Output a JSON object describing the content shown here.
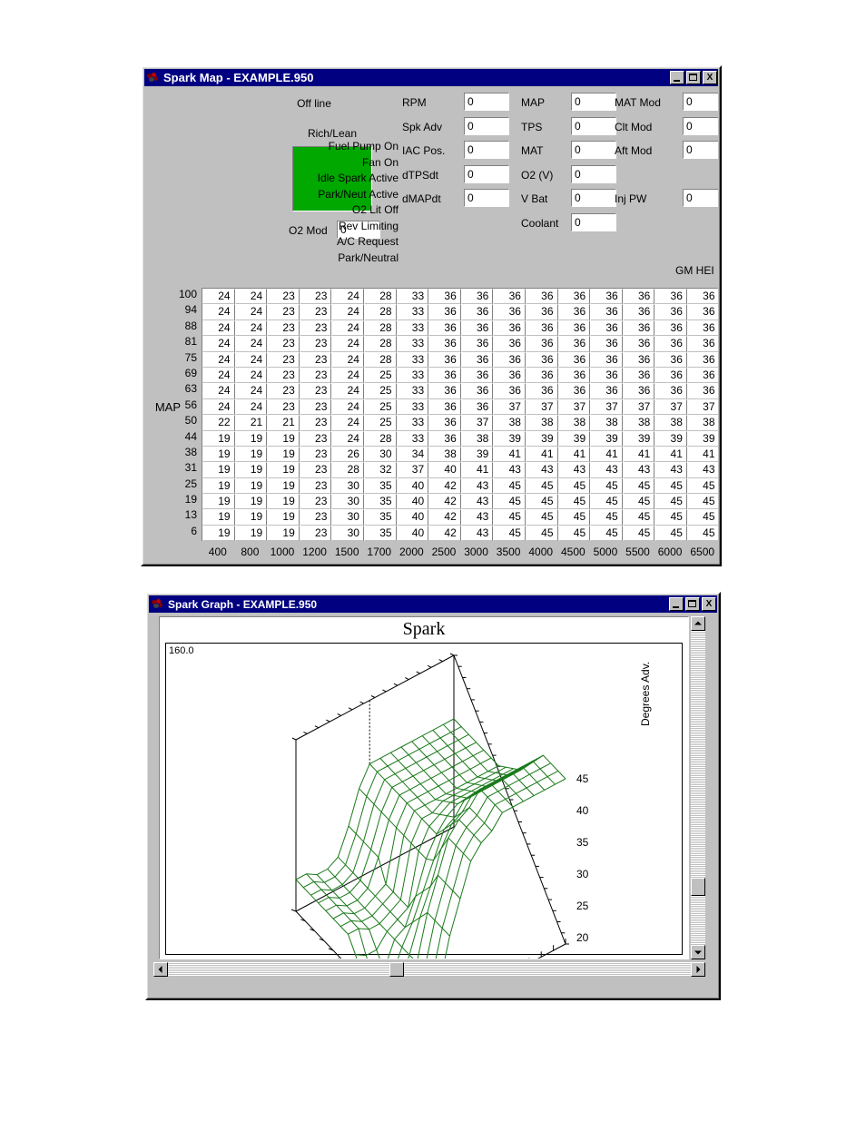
{
  "spark_map_window": {
    "title": "Spark Map - EXAMPLE.950",
    "window_buttons": {
      "minimize": "minimize-icon",
      "maximize": "maximize-icon",
      "close": "X"
    },
    "connection_status": "Off line",
    "rich_lean_label": "Rich/Lean",
    "rich_lean_color": "#00a800",
    "o2_mod_label": "O2 Mod",
    "o2_mod_value": "0",
    "ecm_type": "GM HEI",
    "status_flags": [
      "Fuel Pump On",
      "Fan On",
      "Idle Spark Active",
      "Park/Neut Active",
      "O2 Lit Off",
      "Rev Limiting",
      "A/C Request",
      "Park/Neutral"
    ],
    "gauges_col1": [
      {
        "label": "RPM",
        "value": "0"
      },
      {
        "label": "Spk Adv",
        "value": "0"
      },
      {
        "label": "IAC Pos.",
        "value": "0"
      },
      {
        "label": "dTPSdt",
        "value": "0"
      },
      {
        "label": "dMAPdt",
        "value": "0"
      }
    ],
    "gauges_col2": [
      {
        "label": "MAP",
        "value": "0"
      },
      {
        "label": "TPS",
        "value": "0"
      },
      {
        "label": "MAT",
        "value": "0"
      },
      {
        "label": "O2 (V)",
        "value": "0"
      },
      {
        "label": "V Bat",
        "value": "0"
      },
      {
        "label": "Coolant",
        "value": "0"
      }
    ],
    "gauges_col3": [
      {
        "label": "MAT Mod",
        "value": "0"
      },
      {
        "label": "Clt Mod",
        "value": "0"
      },
      {
        "label": "Aft Mod",
        "value": "0"
      },
      {
        "label": "Inj PW",
        "value": "0"
      }
    ],
    "table": {
      "y_axis_label": "MAP",
      "row_labels": [
        100,
        94,
        88,
        81,
        75,
        69,
        63,
        56,
        50,
        44,
        38,
        31,
        25,
        19,
        13,
        6
      ],
      "col_labels": [
        400,
        800,
        1000,
        1200,
        1500,
        1700,
        2000,
        2500,
        3000,
        3500,
        4000,
        4500,
        5000,
        5500,
        6000,
        6500
      ],
      "rows": [
        [
          24,
          24,
          23,
          23,
          24,
          28,
          33,
          36,
          36,
          36,
          36,
          36,
          36,
          36,
          36,
          36
        ],
        [
          24,
          24,
          23,
          23,
          24,
          28,
          33,
          36,
          36,
          36,
          36,
          36,
          36,
          36,
          36,
          36
        ],
        [
          24,
          24,
          23,
          23,
          24,
          28,
          33,
          36,
          36,
          36,
          36,
          36,
          36,
          36,
          36,
          36
        ],
        [
          24,
          24,
          23,
          23,
          24,
          28,
          33,
          36,
          36,
          36,
          36,
          36,
          36,
          36,
          36,
          36
        ],
        [
          24,
          24,
          23,
          23,
          24,
          28,
          33,
          36,
          36,
          36,
          36,
          36,
          36,
          36,
          36,
          36
        ],
        [
          24,
          24,
          23,
          23,
          24,
          25,
          33,
          36,
          36,
          36,
          36,
          36,
          36,
          36,
          36,
          36
        ],
        [
          24,
          24,
          23,
          23,
          24,
          25,
          33,
          36,
          36,
          36,
          36,
          36,
          36,
          36,
          36,
          36
        ],
        [
          24,
          24,
          23,
          23,
          24,
          25,
          33,
          36,
          36,
          37,
          37,
          37,
          37,
          37,
          37,
          37
        ],
        [
          22,
          21,
          21,
          23,
          24,
          25,
          33,
          36,
          37,
          38,
          38,
          38,
          38,
          38,
          38,
          38
        ],
        [
          19,
          19,
          19,
          23,
          24,
          28,
          33,
          36,
          38,
          39,
          39,
          39,
          39,
          39,
          39,
          39
        ],
        [
          19,
          19,
          19,
          23,
          26,
          30,
          34,
          38,
          39,
          41,
          41,
          41,
          41,
          41,
          41,
          41
        ],
        [
          19,
          19,
          19,
          23,
          28,
          32,
          37,
          40,
          41,
          43,
          43,
          43,
          43,
          43,
          43,
          43
        ],
        [
          19,
          19,
          19,
          23,
          30,
          35,
          40,
          42,
          43,
          45,
          45,
          45,
          45,
          45,
          45,
          45
        ],
        [
          19,
          19,
          19,
          23,
          30,
          35,
          40,
          42,
          43,
          45,
          45,
          45,
          45,
          45,
          45,
          45
        ],
        [
          19,
          19,
          19,
          23,
          30,
          35,
          40,
          42,
          43,
          45,
          45,
          45,
          45,
          45,
          45,
          45
        ],
        [
          19,
          19,
          19,
          23,
          30,
          35,
          40,
          42,
          43,
          45,
          45,
          45,
          45,
          45,
          45,
          45
        ]
      ]
    }
  },
  "spark_graph_window": {
    "title": "Spark Graph - EXAMPLE.950",
    "window_buttons": {
      "minimize": "minimize-icon",
      "maximize": "maximize-icon",
      "close": "X"
    },
    "chart_title": "Spark",
    "z_max_label": "160.0",
    "z_axis_label": "Degrees Adv.",
    "z_ticks": [
      "45",
      "40",
      "35",
      "30",
      "25",
      "20"
    ],
    "mesh_color": "#1a7a1a",
    "marker_color": "#8b1a1a"
  },
  "chart_data": {
    "type": "surface",
    "title": "Spark",
    "xlabel": "RPM",
    "ylabel": "MAP",
    "zlabel": "Degrees Adv.",
    "z_ticks": [
      20,
      25,
      30,
      35,
      40,
      45
    ],
    "zlim": [
      19,
      45
    ],
    "corner_label": "160.0",
    "x": [
      400,
      800,
      1000,
      1200,
      1500,
      1700,
      2000,
      2500,
      3000,
      3500,
      4000,
      4500,
      5000,
      5500,
      6000,
      6500
    ],
    "y": [
      100,
      94,
      88,
      81,
      75,
      69,
      63,
      56,
      50,
      44,
      38,
      31,
      25,
      19,
      13,
      6
    ],
    "z": [
      [
        24,
        24,
        23,
        23,
        24,
        28,
        33,
        36,
        36,
        36,
        36,
        36,
        36,
        36,
        36,
        36
      ],
      [
        24,
        24,
        23,
        23,
        24,
        28,
        33,
        36,
        36,
        36,
        36,
        36,
        36,
        36,
        36,
        36
      ],
      [
        24,
        24,
        23,
        23,
        24,
        28,
        33,
        36,
        36,
        36,
        36,
        36,
        36,
        36,
        36,
        36
      ],
      [
        24,
        24,
        23,
        23,
        24,
        28,
        33,
        36,
        36,
        36,
        36,
        36,
        36,
        36,
        36,
        36
      ],
      [
        24,
        24,
        23,
        23,
        24,
        28,
        33,
        36,
        36,
        36,
        36,
        36,
        36,
        36,
        36,
        36
      ],
      [
        24,
        24,
        23,
        23,
        24,
        25,
        33,
        36,
        36,
        36,
        36,
        36,
        36,
        36,
        36,
        36
      ],
      [
        24,
        24,
        23,
        23,
        24,
        25,
        33,
        36,
        36,
        36,
        36,
        36,
        36,
        36,
        36,
        36
      ],
      [
        24,
        24,
        23,
        23,
        24,
        25,
        33,
        36,
        36,
        37,
        37,
        37,
        37,
        37,
        37,
        37
      ],
      [
        22,
        21,
        21,
        23,
        24,
        25,
        33,
        36,
        37,
        38,
        38,
        38,
        38,
        38,
        38,
        38
      ],
      [
        19,
        19,
        19,
        23,
        24,
        28,
        33,
        36,
        38,
        39,
        39,
        39,
        39,
        39,
        39,
        39
      ],
      [
        19,
        19,
        19,
        23,
        26,
        30,
        34,
        38,
        39,
        41,
        41,
        41,
        41,
        41,
        41,
        41
      ],
      [
        19,
        19,
        19,
        23,
        28,
        32,
        37,
        40,
        41,
        43,
        43,
        43,
        43,
        43,
        43,
        43
      ],
      [
        19,
        19,
        19,
        23,
        30,
        35,
        40,
        42,
        43,
        45,
        45,
        45,
        45,
        45,
        45,
        45
      ],
      [
        19,
        19,
        19,
        23,
        30,
        35,
        40,
        42,
        43,
        45,
        45,
        45,
        45,
        45,
        45,
        45
      ],
      [
        19,
        19,
        19,
        23,
        30,
        35,
        40,
        42,
        43,
        45,
        45,
        45,
        45,
        45,
        45,
        45
      ],
      [
        19,
        19,
        19,
        23,
        30,
        35,
        40,
        42,
        43,
        45,
        45,
        45,
        45,
        45,
        45,
        45
      ]
    ]
  }
}
